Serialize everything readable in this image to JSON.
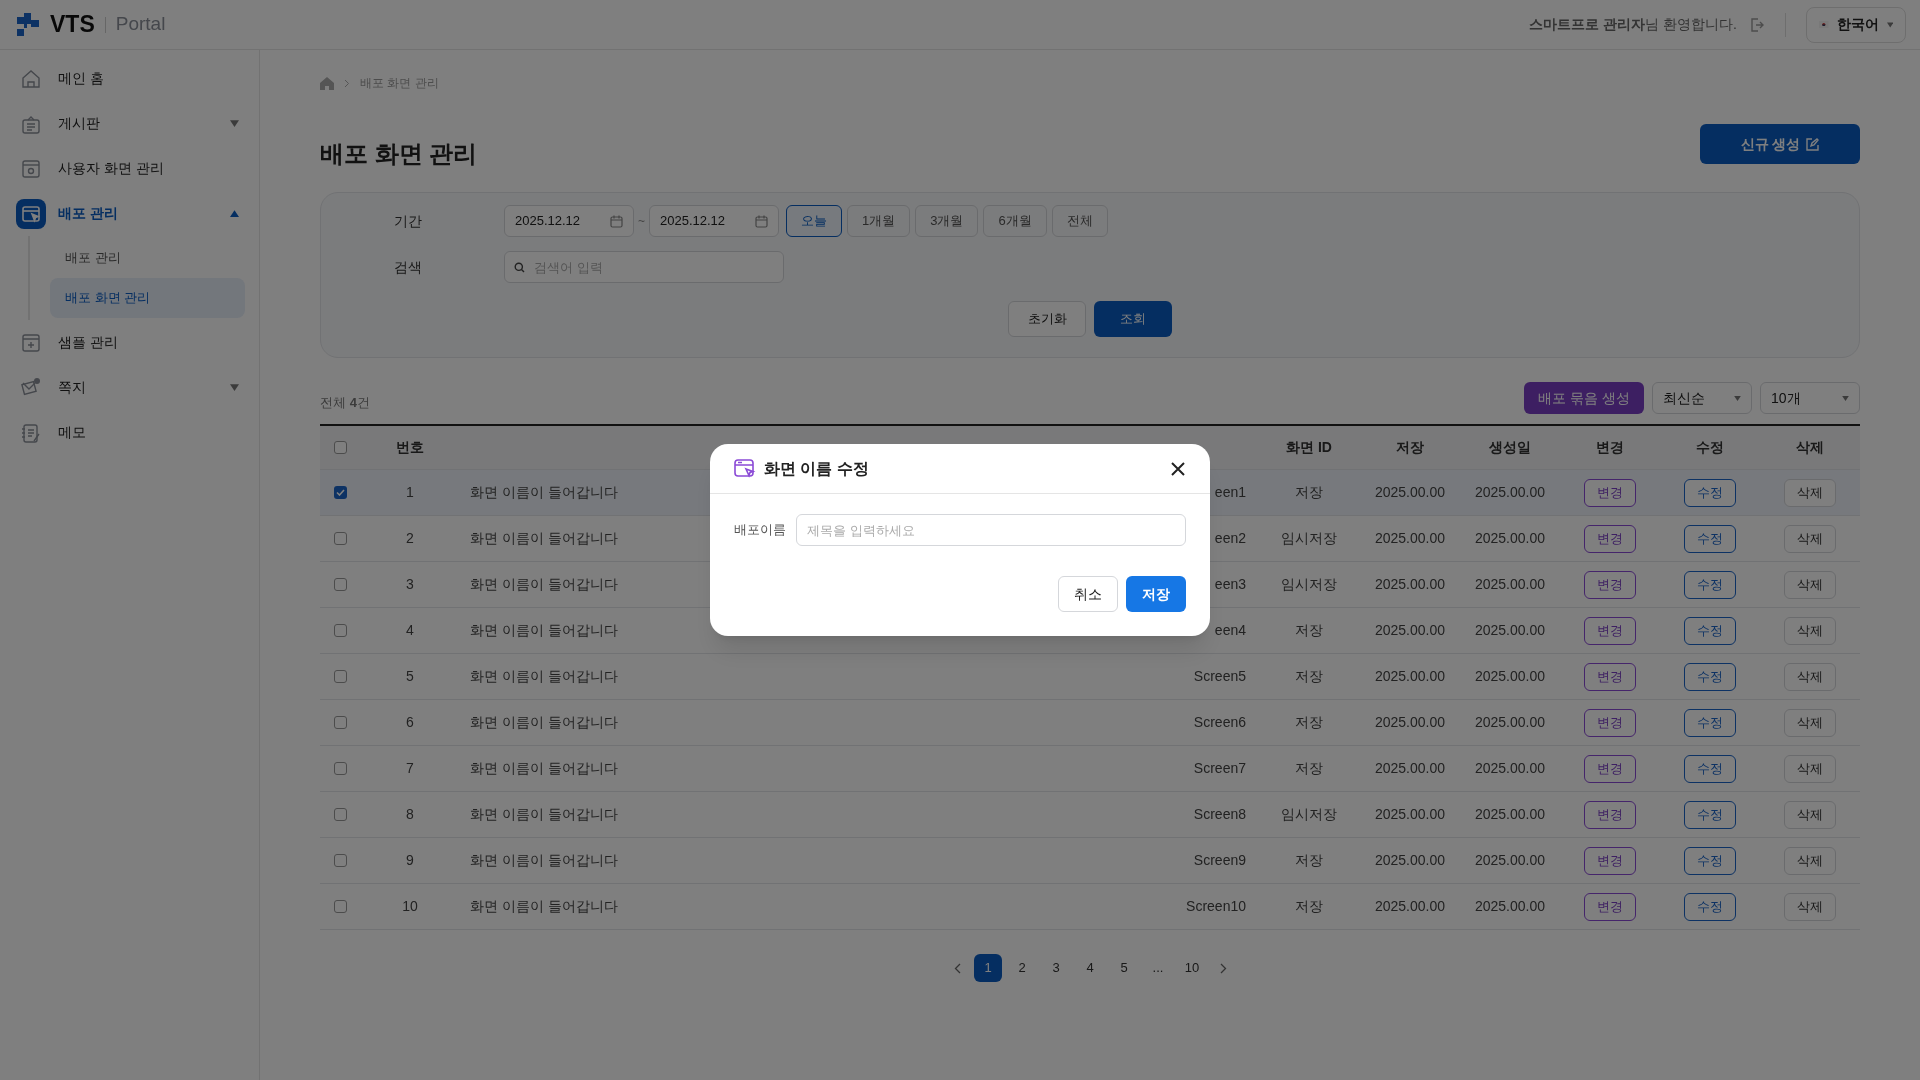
{
  "header": {
    "logo_text": "VTS",
    "portal_text": "Portal",
    "welcome": "**스마트프로 관리자**님 환영합니다.",
    "language": "한국어"
  },
  "sidebar": {
    "items": [
      {
        "kind": "home",
        "label": "메인 홈",
        "selected": false
      },
      {
        "kind": "board",
        "label": "게시판",
        "selected": false,
        "expanded": false
      },
      {
        "kind": "screen",
        "label": "사용자 화면 관리",
        "selected": false
      },
      {
        "kind": "deploy",
        "label": "배포 관리",
        "selected": true,
        "expanded": true,
        "children": [
          {
            "label": "배포 관리",
            "selected": false
          },
          {
            "label": "배포 화면 관리",
            "selected": true
          }
        ]
      },
      {
        "kind": "sample",
        "label": "샘플 관리",
        "selected": false
      },
      {
        "kind": "note",
        "label": "쪽지",
        "selected": false,
        "expanded": false
      },
      {
        "kind": "memo",
        "label": "메모",
        "selected": false
      }
    ]
  },
  "breadcrumb": [
    "배포 화면 관리"
  ],
  "page_title": "배포 화면 관리",
  "new_button": "신규 생성",
  "filter": {
    "period_label": "기간",
    "date_from": "2025.12.12",
    "separator": "~",
    "date_to": "2025.12.12",
    "ranges": [
      {
        "label": "오늘",
        "selected": true
      },
      {
        "label": "1개월",
        "selected": false
      },
      {
        "label": "3개월",
        "selected": false
      },
      {
        "label": "6개월",
        "selected": false
      },
      {
        "label": "전체",
        "selected": false
      }
    ],
    "search_label": "검색",
    "search_placeholder": "검색어 입력",
    "reset_button": "초기화",
    "query_button": "조회"
  },
  "list": {
    "total": "전체 **4**건",
    "bundle_button": "배포 묶음 생성",
    "sort": "최신순",
    "page_size": "10개"
  },
  "table": {
    "select_all_checked": false,
    "headers": [
      "번호",
      "화면 ID",
      "저장",
      "생성일",
      "변경",
      "수정",
      "삭제"
    ],
    "rows": [
      {
        "checked": true,
        "no": "1",
        "name": "화면 이름이 들어갑니다",
        "screen_id": "een1",
        "save": "저장",
        "date_1": "2025.00.00",
        "date_2": "2025.00.00",
        "change": "변경",
        "edit": "수정",
        "delete": "삭제"
      },
      {
        "checked": false,
        "no": "2",
        "name": "화면 이름이 들어갑니다",
        "screen_id": "een2",
        "save": "임시저장",
        "date_1": "2025.00.00",
        "date_2": "2025.00.00",
        "change": "변경",
        "edit": "수정",
        "delete": "삭제"
      },
      {
        "checked": false,
        "no": "3",
        "name": "화면 이름이 들어갑니다",
        "screen_id": "een3",
        "save": "임시저장",
        "date_1": "2025.00.00",
        "date_2": "2025.00.00",
        "change": "변경",
        "edit": "수정",
        "delete": "삭제"
      },
      {
        "checked": false,
        "no": "4",
        "name": "화면 이름이 들어갑니다",
        "screen_id": "een4",
        "save": "저장",
        "date_1": "2025.00.00",
        "date_2": "2025.00.00",
        "change": "변경",
        "edit": "수정",
        "delete": "삭제"
      },
      {
        "checked": false,
        "no": "5",
        "name": "화면 이름이 들어갑니다",
        "screen_id": "Screen5",
        "save": "저장",
        "date_1": "2025.00.00",
        "date_2": "2025.00.00",
        "change": "변경",
        "edit": "수정",
        "delete": "삭제"
      },
      {
        "checked": false,
        "no": "6",
        "name": "화면 이름이 들어갑니다",
        "screen_id": "Screen6",
        "save": "저장",
        "date_1": "2025.00.00",
        "date_2": "2025.00.00",
        "change": "변경",
        "edit": "수정",
        "delete": "삭제"
      },
      {
        "checked": false,
        "no": "7",
        "name": "화면 이름이 들어갑니다",
        "screen_id": "Screen7",
        "save": "저장",
        "date_1": "2025.00.00",
        "date_2": "2025.00.00",
        "change": "변경",
        "edit": "수정",
        "delete": "삭제"
      },
      {
        "checked": false,
        "no": "8",
        "name": "화면 이름이 들어갑니다",
        "screen_id": "Screen8",
        "save": "임시저장",
        "date_1": "2025.00.00",
        "date_2": "2025.00.00",
        "change": "변경",
        "edit": "수정",
        "delete": "삭제"
      },
      {
        "checked": false,
        "no": "9",
        "name": "화면 이름이 들어갑니다",
        "screen_id": "Screen9",
        "save": "저장",
        "date_1": "2025.00.00",
        "date_2": "2025.00.00",
        "change": "변경",
        "edit": "수정",
        "delete": "삭제"
      },
      {
        "checked": false,
        "no": "10",
        "name": "화면 이름이 들어갑니다",
        "screen_id": "Screen10",
        "save": "저장",
        "date_1": "2025.00.00",
        "date_2": "2025.00.00",
        "change": "변경",
        "edit": "수정",
        "delete": "삭제"
      }
    ]
  },
  "pagination": {
    "pages": [
      {
        "label": "1",
        "selected": true
      },
      {
        "label": "2",
        "selected": false
      },
      {
        "label": "3",
        "selected": false
      },
      {
        "label": "4",
        "selected": false
      },
      {
        "label": "5",
        "selected": false
      },
      {
        "label": "...",
        "selected": false
      },
      {
        "label": "10",
        "selected": false
      }
    ]
  },
  "modal": {
    "title": "화면 이름 수정",
    "field_label": "배포이름",
    "placeholder": "제목을 입력하세요",
    "cancel_button": "취소",
    "save_button": "저장"
  }
}
